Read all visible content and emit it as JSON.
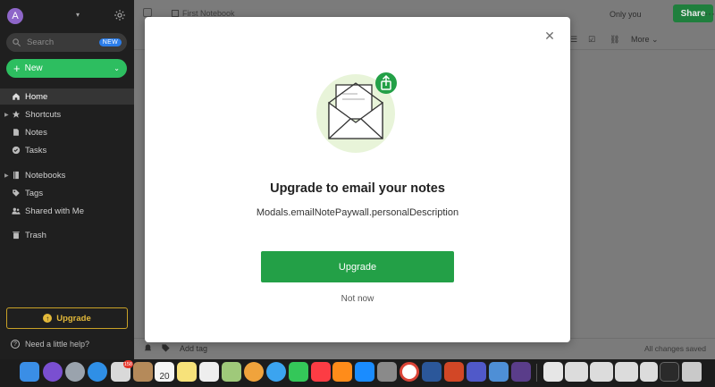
{
  "sidebar": {
    "avatar_letter": "A",
    "search_placeholder": "Search",
    "search_badge": "NEW",
    "new_label": "New",
    "items": [
      {
        "label": "Home",
        "icon": "home-icon",
        "active": true
      },
      {
        "label": "Shortcuts",
        "icon": "star-icon",
        "expandable": true
      },
      {
        "label": "Notes",
        "icon": "note-icon"
      },
      {
        "label": "Tasks",
        "icon": "check-circle-icon"
      },
      {
        "label": "Notebooks",
        "icon": "notebook-icon",
        "expandable": true
      },
      {
        "label": "Tags",
        "icon": "tag-icon"
      },
      {
        "label": "Shared with Me",
        "icon": "people-icon"
      },
      {
        "label": "Trash",
        "icon": "trash-icon"
      }
    ],
    "upgrade_label": "Upgrade",
    "help_label": "Need a little help?"
  },
  "editor": {
    "notebook_name": "First Notebook",
    "visibility": "Only you",
    "share_label": "Share",
    "more_menu": "More",
    "add_tag": "Add tag",
    "save_status": "All changes saved"
  },
  "modal": {
    "title": "Upgrade to email your notes",
    "description": "Modals.emailNotePaywall.personalDescription",
    "primary_button": "Upgrade",
    "secondary_button": "Not now"
  },
  "dock": {
    "badges": {
      "photos": "158",
      "calendar_day": "20"
    }
  },
  "colors": {
    "accent_green": "#23a047",
    "sidebar_bg": "#1f1f1f",
    "upgrade_gold": "#e3b93a"
  }
}
